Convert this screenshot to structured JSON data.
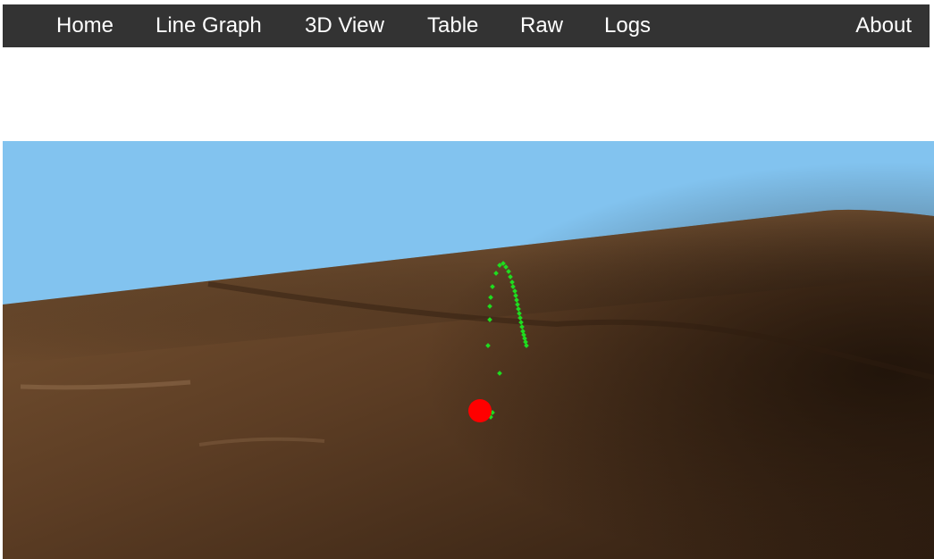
{
  "nav": {
    "items": [
      {
        "id": "home",
        "label": "Home"
      },
      {
        "id": "line-graph",
        "label": "Line Graph"
      },
      {
        "id": "3d-view",
        "label": "3D View"
      },
      {
        "id": "table",
        "label": "Table"
      },
      {
        "id": "raw",
        "label": "Raw"
      },
      {
        "id": "logs",
        "label": "Logs"
      }
    ],
    "about_label": "About"
  },
  "scene": {
    "sky_color": "#82c3ef",
    "terrain_color": "#5a3c24",
    "trajectory_color": "#1fdc1f",
    "marker_color": "#ff0000"
  }
}
